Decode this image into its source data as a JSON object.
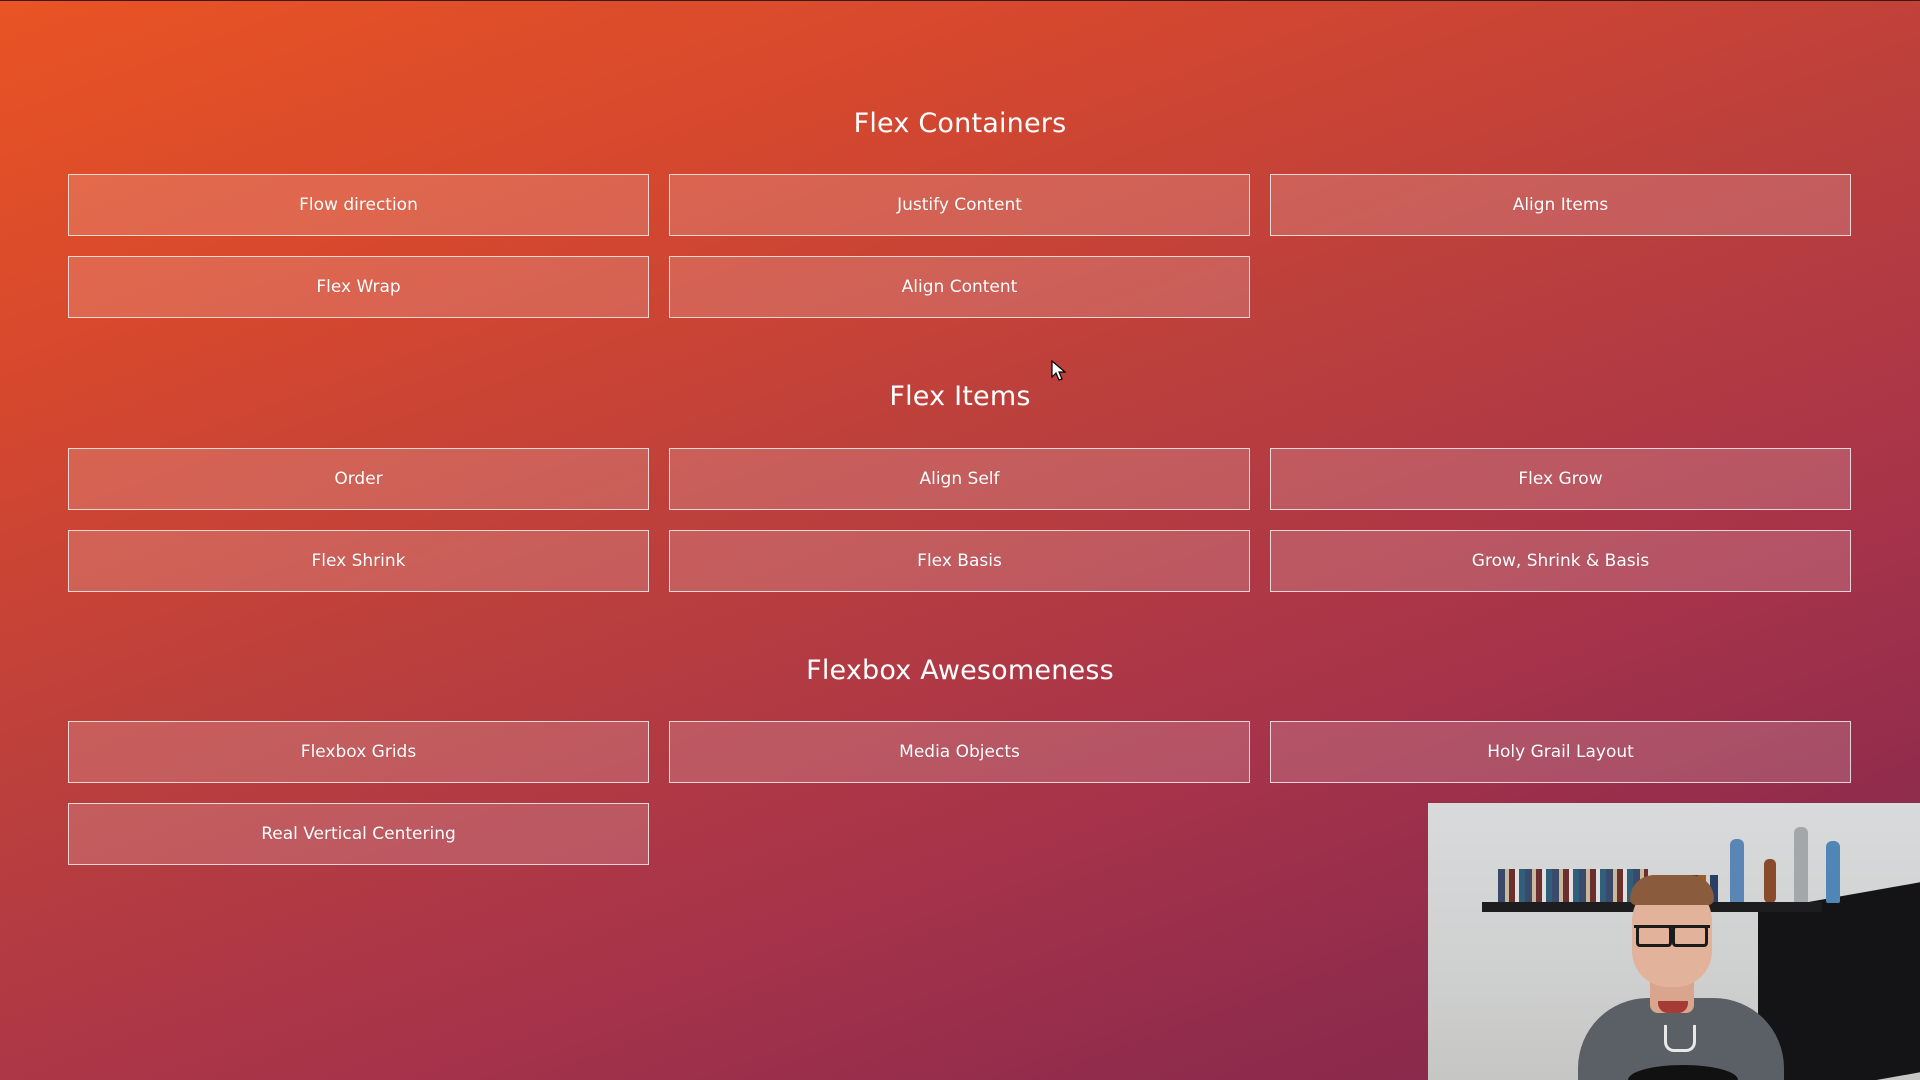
{
  "sections": [
    {
      "title": "Flex Containers",
      "items": [
        "Flow direction",
        "Justify Content",
        "Align Items",
        "Flex Wrap",
        "Align Content"
      ]
    },
    {
      "title": "Flex Items",
      "items": [
        "Order",
        "Align Self",
        "Flex Grow",
        "Flex Shrink",
        "Flex Basis",
        "Grow, Shrink & Basis"
      ]
    },
    {
      "title": "Flexbox Awesomeness",
      "items": [
        "Flexbox Grids",
        "Media Objects",
        "Holy Grail Layout",
        "Real Vertical Centering"
      ]
    }
  ],
  "colors": {
    "gradient_start": "#e95424",
    "gradient_end": "#82284d",
    "tile_border": "#ffffff",
    "text": "#ffffff"
  },
  "overlay": {
    "type": "webcam-feed"
  },
  "cursor": {
    "icon": "arrow-cursor-icon"
  }
}
